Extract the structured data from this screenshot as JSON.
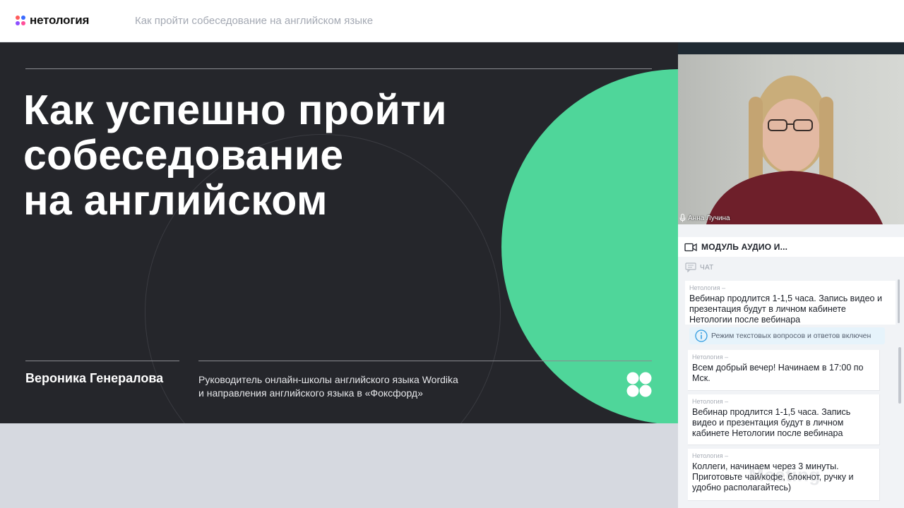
{
  "header": {
    "logo_text": "нетология",
    "page_title": "Как пройти собеседование на английском языке"
  },
  "slide": {
    "headline": "Как успешно пройти\nсобеседование\nна английском",
    "speaker_name": "Вероника Генералова",
    "speaker_role": "Руководитель онлайн-школы английского языка Wordika\nи направления английского языка в «Фоксфорд»",
    "accent_color": "#4fd69a",
    "background_color": "#25262b"
  },
  "video": {
    "presenter_name": "Анна Лучина"
  },
  "module": {
    "label": "МОДУЛЬ АУДИО И..."
  },
  "chat": {
    "header_label": "ЧАТ",
    "pinned": {
      "author": "Нетология –",
      "text": "Вебинар продлится 1-1,5 часа. Запись видео и презентация будут в личном кабинете Нетологии после вебинара"
    },
    "info_banner": "Режим текстовых вопросов и ответов включен",
    "messages": [
      {
        "author": "Нетология –",
        "text": "Всем добрый вечер! Начинаем в 17:00 по Мск."
      },
      {
        "author": "Нетология –",
        "text": "Вебинар продлится 1-1,5 часа. Запись видео и презентация будут в личном кабинете Нетологии после вебинара"
      },
      {
        "author": "Нетология –",
        "text": "Коллеги, начинаем через 3 минуты. Приготовьте чай/кофе, блокнот, ручку и удобно располагайтесь)"
      }
    ],
    "watermark": "Meeting"
  }
}
